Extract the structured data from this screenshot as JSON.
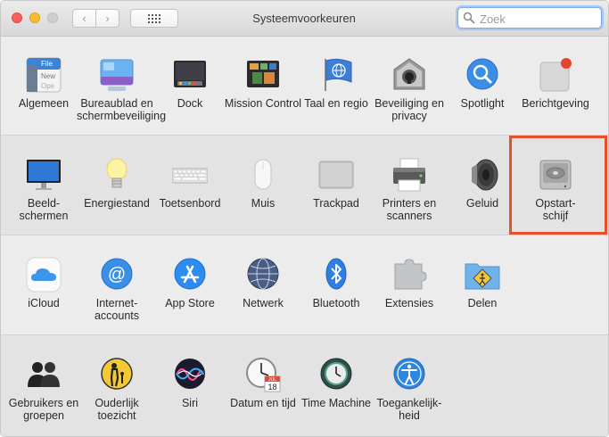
{
  "window": {
    "title": "Systeemvoorkeuren",
    "search_placeholder": "Zoek",
    "nav_back": "‹",
    "nav_forward": "›"
  },
  "rows": [
    [
      {
        "id": "algemeen",
        "label": "Algemeen",
        "icon": "general-icon"
      },
      {
        "id": "bureaublad",
        "label": "Bureaublad en schermbeveiliging",
        "icon": "desktop-screensaver-icon"
      },
      {
        "id": "dock",
        "label": "Dock",
        "icon": "dock-icon"
      },
      {
        "id": "mission-control",
        "label": "Mission Control",
        "icon": "mission-control-icon"
      },
      {
        "id": "taal",
        "label": "Taal en regio",
        "icon": "language-region-icon"
      },
      {
        "id": "beveiliging",
        "label": "Beveiliging en privacy",
        "icon": "security-privacy-icon"
      },
      {
        "id": "spotlight",
        "label": "Spotlight",
        "icon": "spotlight-icon"
      },
      {
        "id": "berichtgeving",
        "label": "Berichtgeving",
        "icon": "notifications-icon"
      }
    ],
    [
      {
        "id": "beeldschermen",
        "label": "Beeld-\nschermen",
        "icon": "displays-icon"
      },
      {
        "id": "energiestand",
        "label": "Energiestand",
        "icon": "energy-saver-icon"
      },
      {
        "id": "toetsenbord",
        "label": "Toetsenbord",
        "icon": "keyboard-icon"
      },
      {
        "id": "muis",
        "label": "Muis",
        "icon": "mouse-icon"
      },
      {
        "id": "trackpad",
        "label": "Trackpad",
        "icon": "trackpad-icon"
      },
      {
        "id": "printers",
        "label": "Printers en scanners",
        "icon": "printer-icon"
      },
      {
        "id": "geluid",
        "label": "Geluid",
        "icon": "sound-icon"
      },
      {
        "id": "opstartschijf",
        "label": "Opstart-\nschijf",
        "icon": "startup-disk-icon"
      }
    ],
    [
      {
        "id": "icloud",
        "label": "iCloud",
        "icon": "icloud-icon"
      },
      {
        "id": "internetaccounts",
        "label": "Internet-\naccounts",
        "icon": "internet-accounts-icon"
      },
      {
        "id": "appstore",
        "label": "App Store",
        "icon": "app-store-icon"
      },
      {
        "id": "netwerk",
        "label": "Netwerk",
        "icon": "network-icon"
      },
      {
        "id": "bluetooth",
        "label": "Bluetooth",
        "icon": "bluetooth-icon"
      },
      {
        "id": "extensies",
        "label": "Extensies",
        "icon": "extensions-icon"
      },
      {
        "id": "delen",
        "label": "Delen",
        "icon": "sharing-icon"
      }
    ],
    [
      {
        "id": "gebruikers",
        "label": "Gebruikers en groepen",
        "icon": "users-groups-icon"
      },
      {
        "id": "ouderlijk",
        "label": "Ouderlijk toezicht",
        "icon": "parental-controls-icon"
      },
      {
        "id": "siri",
        "label": "Siri",
        "icon": "siri-icon"
      },
      {
        "id": "datum",
        "label": "Datum en tijd",
        "icon": "date-time-icon"
      },
      {
        "id": "timemachine",
        "label": "Time Machine",
        "icon": "time-machine-icon"
      },
      {
        "id": "toegankelijkheid",
        "label": "Toegankelijk-\nheid",
        "icon": "accessibility-icon"
      }
    ]
  ],
  "icon_text": {
    "general_file": "File",
    "general_new": "New",
    "general_open": "Ope",
    "calendar_month": "JUL",
    "calendar_day": "18"
  },
  "highlighted_pane": "opstartschijf",
  "colors": {
    "highlight": "#e8502a",
    "search_focus": "#7eaae8"
  }
}
